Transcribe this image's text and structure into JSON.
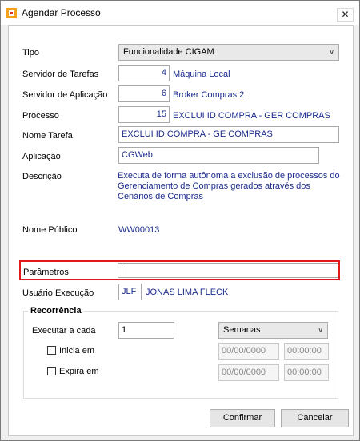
{
  "window": {
    "title": "Agendar Processo",
    "close_glyph": "✕"
  },
  "form": {
    "tipo": {
      "label": "Tipo",
      "value": "Funcionalidade CIGAM"
    },
    "servidor_tarefas": {
      "label": "Servidor de Tarefas",
      "code": "4",
      "name": "Máquina Local"
    },
    "servidor_aplicacao": {
      "label": "Servidor de Aplicação",
      "code": "6",
      "name": "Broker Compras 2"
    },
    "processo": {
      "label": "Processo",
      "code": "15",
      "name": "EXCLUI ID COMPRA - GER COMPRAS"
    },
    "nome_tarefa": {
      "label": "Nome Tarefa",
      "value": "EXCLUI ID COMPRA - GE COMPRAS"
    },
    "aplicacao": {
      "label": "Aplicação",
      "value": "CGWeb"
    },
    "descricao": {
      "label": "Descrição",
      "lines": [
        "Executa de forma autônoma a exclusão de processos do",
        "Gerenciamento de Compras gerados através dos",
        "Cenários de Compras"
      ]
    },
    "nome_publico": {
      "label": "Nome Público",
      "value": "WW00013"
    },
    "parametros": {
      "label": "Parâmetros",
      "value": ""
    },
    "usuario_execucao": {
      "label": "Usuário Execução",
      "code": "JLF",
      "name": "JONAS LIMA FLECK"
    }
  },
  "recorrencia": {
    "title": "Recorrência",
    "executar_label": "Executar a cada",
    "executar_value": "1",
    "unit": "Semanas",
    "inicia": {
      "label": "Inicia em",
      "checked": false,
      "date": "00/00/0000",
      "time": "00:00:00"
    },
    "expira": {
      "label": "Expira em",
      "checked": false,
      "date": "00/00/0000",
      "time": "00:00:00"
    }
  },
  "buttons": {
    "confirmar": "Confirmar",
    "cancelar": "Cancelar"
  },
  "colors": {
    "value_text": "#1a2b8c",
    "highlight": "#e01a1a"
  }
}
